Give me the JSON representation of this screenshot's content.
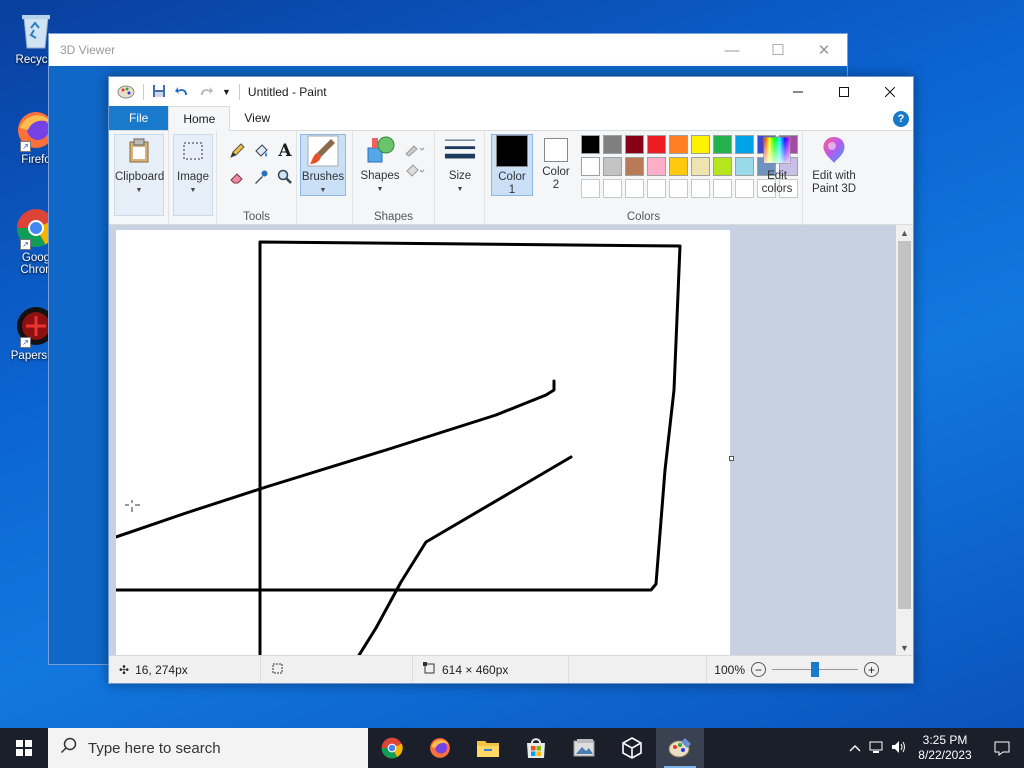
{
  "desktop": {
    "icons": [
      {
        "label": "Recycle",
        "icon": "recycle-bin-icon"
      },
      {
        "label": "Firefo",
        "icon": "firefox-icon"
      },
      {
        "label": "Goog\nChron",
        "line1": "Goog",
        "line2": "Chron",
        "icon": "chrome-icon"
      },
      {
        "label": "Papers, P",
        "icon": "papers-please-icon"
      }
    ]
  },
  "viewer": {
    "title": "3D Viewer"
  },
  "paint": {
    "title": "Untitled - Paint",
    "tabs": {
      "file": "File",
      "home": "Home",
      "view": "View"
    },
    "help": "?",
    "ribbon": {
      "clipboard": "Clipboard",
      "image": "Image",
      "tools_label": "Tools",
      "brushes": "Brushes",
      "shapes_btn": "Shapes",
      "shapes_label": "Shapes",
      "size": "Size",
      "color1_line1": "Color",
      "color1_line2": "1",
      "color2_line1": "Color",
      "color2_line2": "2",
      "colors_label": "Colors",
      "edit_colors_line1": "Edit",
      "edit_colors_line2": "colors",
      "paint3d_line1": "Edit with",
      "paint3d_line2": "Paint 3D"
    },
    "palette": {
      "row1": [
        "#000000",
        "#7f7f7f",
        "#880015",
        "#ed1c24",
        "#ff7f27",
        "#fff200",
        "#22b14c",
        "#00a2e8",
        "#3f48cc",
        "#a349a4"
      ],
      "row2": [
        "#ffffff",
        "#c3c3c3",
        "#b97a57",
        "#ffaec9",
        "#ffc90e",
        "#efe4b0",
        "#b5e61d",
        "#99d9ea",
        "#7092be",
        "#c8bfe7"
      ]
    },
    "color1": "#000000",
    "color2": "#ffffff",
    "status": {
      "cursor_pos": "16, 274px",
      "canvas_size": "614 × 460px",
      "zoom": "100%",
      "zoom_level": 0.5
    }
  },
  "taskbar": {
    "search_placeholder": "Type here to search",
    "time": "3:25 PM",
    "date": "8/22/2023",
    "apps": [
      "chrome-icon",
      "firefox-icon",
      "file-explorer-icon",
      "store-icon",
      "photos-icon",
      "3d-viewer-icon",
      "paint-icon"
    ]
  }
}
